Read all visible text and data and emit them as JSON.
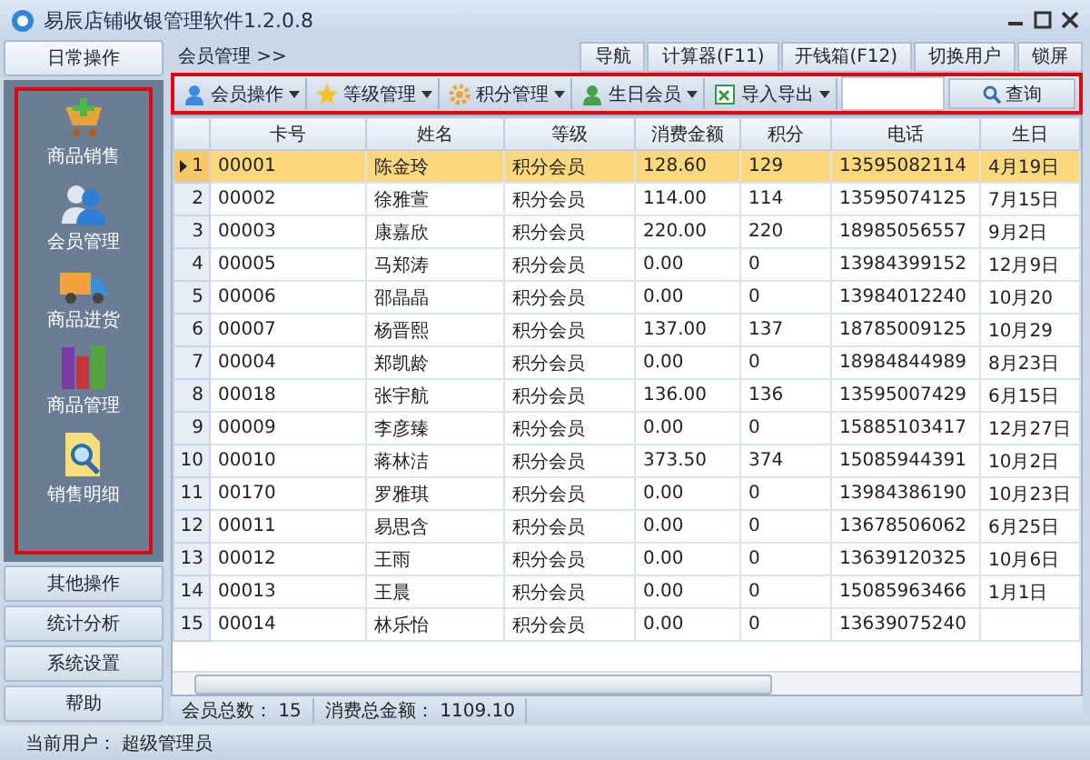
{
  "window": {
    "title": "易辰店铺收银管理软件1.2.0.8"
  },
  "sidebar": {
    "sections": [
      {
        "label": "日常操作",
        "selected": true
      },
      {
        "label": "其他操作",
        "selected": false
      },
      {
        "label": "统计分析",
        "selected": false
      },
      {
        "label": "系统设置",
        "selected": false
      },
      {
        "label": "帮助",
        "selected": false
      }
    ],
    "items": [
      "商品销售",
      "会员管理",
      "商品进货",
      "商品管理",
      "销售明细"
    ]
  },
  "breadcrumb": "会员管理 >>",
  "top_buttons": [
    "导航",
    "计算器(F11)",
    "开钱箱(F12)",
    "切换用户",
    "锁屏"
  ],
  "toolbar": {
    "menus": [
      "会员操作",
      "等级管理",
      "积分管理",
      "生日会员",
      "导入导出"
    ],
    "search_button": "查询"
  },
  "table": {
    "columns": [
      "卡号",
      "姓名",
      "等级",
      "消费金额",
      "积分",
      "电话",
      "生日"
    ],
    "rows": [
      {
        "index": "1",
        "cells": [
          "00001",
          "陈金玲",
          "积分会员",
          "128.60",
          "129",
          "13595082114",
          "4月19日"
        ],
        "selected": true
      },
      {
        "index": "2",
        "cells": [
          "00002",
          "徐雅萱",
          "积分会员",
          "114.00",
          "114",
          "13595074125",
          "7月15日"
        ],
        "selected": false
      },
      {
        "index": "3",
        "cells": [
          "00003",
          "康嘉欣",
          "积分会员",
          "220.00",
          "220",
          "18985056557",
          "9月2日"
        ],
        "selected": false
      },
      {
        "index": "4",
        "cells": [
          "00005",
          "马郑涛",
          "积分会员",
          "0.00",
          "0",
          "13984399152",
          "12月9日"
        ],
        "selected": false
      },
      {
        "index": "5",
        "cells": [
          "00006",
          "邵晶晶",
          "积分会员",
          "0.00",
          "0",
          "13984012240",
          "10月20"
        ],
        "selected": false
      },
      {
        "index": "6",
        "cells": [
          "00007",
          "杨晋熙",
          "积分会员",
          "137.00",
          "137",
          "18785009125",
          "10月29"
        ],
        "selected": false
      },
      {
        "index": "7",
        "cells": [
          "00004",
          "郑凯龄",
          "积分会员",
          "0.00",
          "0",
          "18984844989",
          "8月23日"
        ],
        "selected": false
      },
      {
        "index": "8",
        "cells": [
          "00018",
          "张宇航",
          "积分会员",
          "136.00",
          "136",
          "13595007429",
          "6月15日"
        ],
        "selected": false
      },
      {
        "index": "9",
        "cells": [
          "00009",
          "李彦臻",
          "积分会员",
          "0.00",
          "0",
          "15885103417",
          "12月27日"
        ],
        "selected": false
      },
      {
        "index": "10",
        "cells": [
          "00010",
          "蒋林洁",
          "积分会员",
          "373.50",
          "374",
          "15085944391",
          "10月2日"
        ],
        "selected": false
      },
      {
        "index": "11",
        "cells": [
          "00170",
          "罗雅琪",
          "积分会员",
          "0.00",
          "0",
          "13984386190",
          "10月23日"
        ],
        "selected": false
      },
      {
        "index": "12",
        "cells": [
          "00011",
          "易思含",
          "积分会员",
          "0.00",
          "0",
          "13678506062",
          "6月25日"
        ],
        "selected": false
      },
      {
        "index": "13",
        "cells": [
          "00012",
          "王雨",
          "积分会员",
          "0.00",
          "0",
          "13639120325",
          "10月6日"
        ],
        "selected": false
      },
      {
        "index": "14",
        "cells": [
          "00013",
          "王晨",
          "积分会员",
          "0.00",
          "0",
          "15085963466",
          "1月1日"
        ],
        "selected": false
      },
      {
        "index": "15",
        "cells": [
          "00014",
          "林乐怡",
          "积分会员",
          "0.00",
          "0",
          "13639075240",
          ""
        ],
        "selected": false
      }
    ]
  },
  "summary": [
    {
      "label": "会员总数：",
      "value": "15"
    },
    {
      "label": "消费总金额：",
      "value": "1109.10"
    }
  ],
  "status_bar": {
    "label": "当前用户：",
    "value": "超级管理员"
  }
}
